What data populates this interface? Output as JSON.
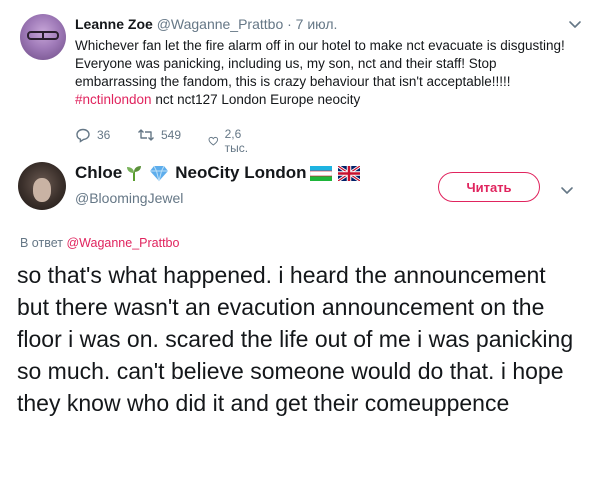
{
  "parent_tweet": {
    "name": "Leanne Zoe",
    "handle": "@Waganne_Prattbo",
    "date": "· 7 июл.",
    "text": "Whichever fan let the fire alarm off in our hotel to make nct evacuate is disgusting! Everyone was panicking, including us, my son, nct and their staff! Stop embarrassing the fandom, this is crazy behaviour that isn't acceptable!!!!!",
    "hashtag": "#nctinlondon",
    "tags_rest": "nct nct127 London Europe neocity",
    "replies": "36",
    "retweets": "549",
    "likes": "2,6 тыс."
  },
  "reply_tweet": {
    "name_1": "Chloe",
    "name_2": "NeoCity London",
    "handle": "@BloomingJewel",
    "follow_label": "Читать",
    "reply_prefix": "В ответ",
    "reply_mention": "@Waganne_Prattbo",
    "text": "so that's what happened. i heard the announcement but there wasn't an evacution announcement on the floor i was on. scared the life out of me i was panicking so much. can't believe someone would do that. i hope they know who did it and get their comeuppence"
  },
  "colors": {
    "accent": "#e0245e",
    "secondary_text": "#657786",
    "primary_text": "#14171a"
  },
  "icons": [
    "reply-icon",
    "retweet-icon",
    "like-icon",
    "chevron-down-icon",
    "seedling-emoji",
    "diamond-emoji",
    "uzbekistan-flag",
    "uk-flag"
  ]
}
